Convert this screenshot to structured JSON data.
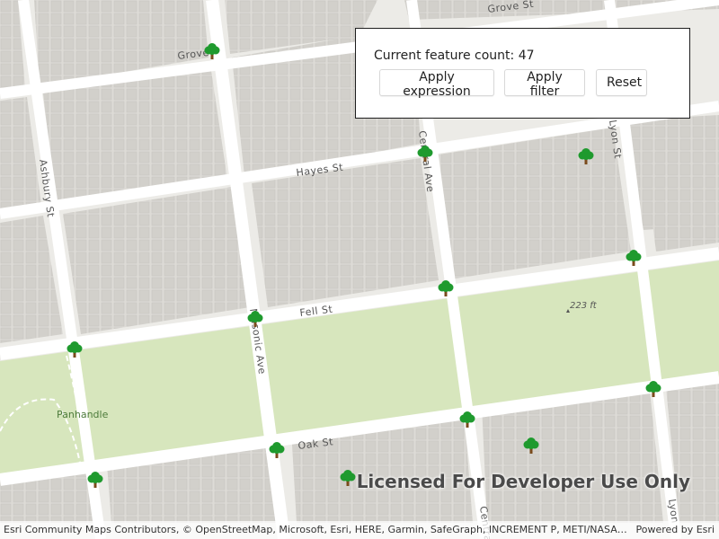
{
  "panel": {
    "count_label": "Current feature count:",
    "count_value": "47",
    "buttons": {
      "apply_expression": "Apply expression",
      "apply_filter": "Apply filter",
      "reset": "Reset"
    }
  },
  "map": {
    "streets": {
      "grove_left": "Grove",
      "grove_right": "Grove St",
      "hayes": "Hayes St",
      "fell": "Fell St",
      "oak": "Oak St",
      "ashbury": "Ashbury St",
      "masonic": "Masonic Ave",
      "central_top": "Central Ave",
      "central_bottom": "Central",
      "lyon_top": "Lyon St",
      "lyon_bottom": "Lyon"
    },
    "park_label": "Panhandle",
    "elevation_label": "223 ft",
    "feature_icon": "tree-icon",
    "colors": {
      "background": "#ecebe7",
      "block": "#dddbd6",
      "building": "#d2d0cb",
      "street": "#ffffff",
      "park": "#d7e6bd",
      "tree_foliage": "#1f9a2e",
      "tree_trunk": "#7a4b1c"
    }
  },
  "watermark": "Licensed For Developer Use Only",
  "attribution": {
    "text": "Esri Community Maps Contributors, © OpenStreetMap, Microsoft, Esri, HERE, Garmin, SafeGraph, INCREMENT P, METI/NASA, USGS, Bureau of Land Management, EPA, NPS, US Census Bureau, USDA, USFWS",
    "powered_by": "Powered by Esri"
  }
}
